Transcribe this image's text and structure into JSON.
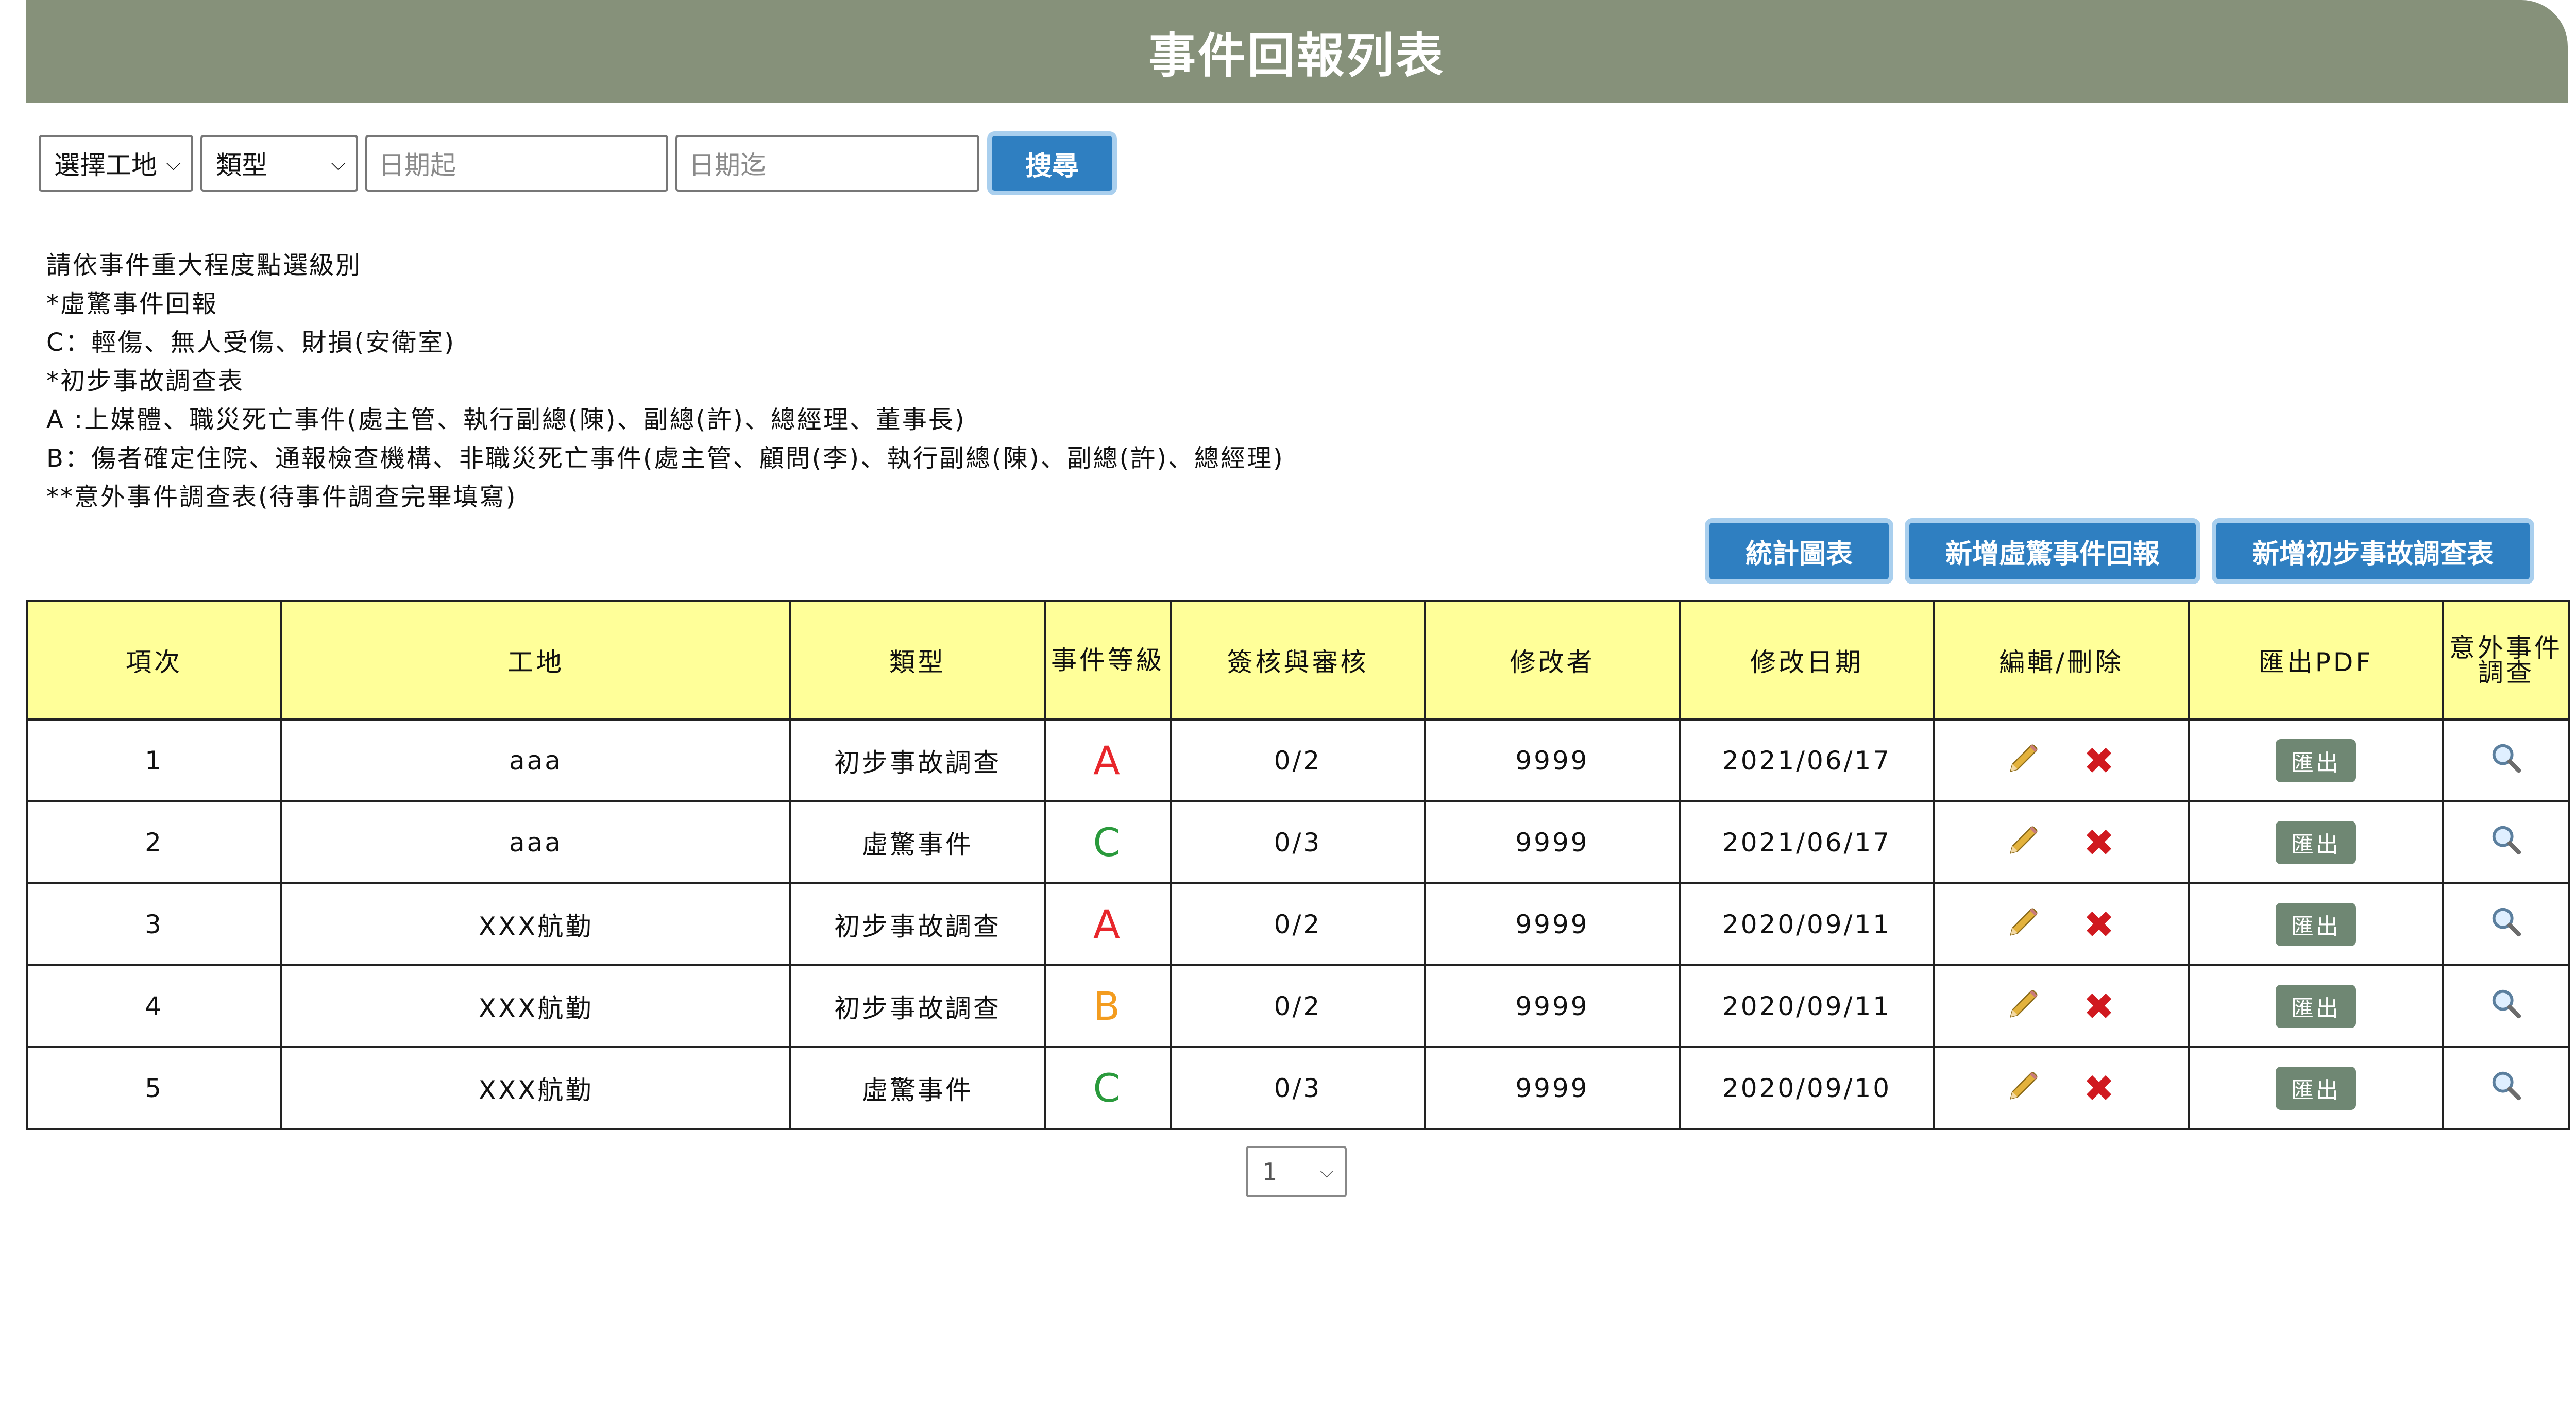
{
  "header": {
    "title": "事件回報列表"
  },
  "filters": {
    "site_select": "選擇工地",
    "type_select": "類型",
    "date_from_placeholder": "日期起",
    "date_to_placeholder": "日期迄",
    "search_label": "搜尋"
  },
  "instructions": [
    "請依事件重大程度點選級別",
    "*虛驚事件回報",
    "C：輕傷、無人受傷、財損(安衛室)",
    "*初步事故調查表",
    "A :上媒體、職災死亡事件(處主管、執行副總(陳)、副總(許)、總經理、董事長)",
    "B：傷者確定住院、通報檢查機構、非職災死亡事件(處主管、顧問(李)、執行副總(陳)、副總(許)、總經理)",
    "**意外事件調查表(待事件調查完畢填寫)"
  ],
  "actions": {
    "stats_chart": "統計圖表",
    "add_near_miss": "新增虛驚事件回報",
    "add_investigation": "新增初步事故調查表"
  },
  "table": {
    "headers": {
      "index": "項次",
      "site": "工地",
      "type": "類型",
      "grade": "事件等級",
      "review": "簽核與審核",
      "modifier": "修改者",
      "modified_date": "修改日期",
      "edit_delete": "編輯/刪除",
      "export_pdf": "匯出PDF",
      "accident": "意外事件調查"
    },
    "export_label": "匯出",
    "rows": [
      {
        "index": "1",
        "site": "aaa",
        "type": "初步事故調查",
        "grade": "A",
        "review": "0/2",
        "modifier": "9999",
        "date": "2021/06/17"
      },
      {
        "index": "2",
        "site": "aaa",
        "type": "虛驚事件",
        "grade": "C",
        "review": "0/3",
        "modifier": "9999",
        "date": "2021/06/17"
      },
      {
        "index": "3",
        "site": "XXX航勤",
        "type": "初步事故調查",
        "grade": "A",
        "review": "0/2",
        "modifier": "9999",
        "date": "2020/09/11"
      },
      {
        "index": "4",
        "site": "XXX航勤",
        "type": "初步事故調查",
        "grade": "B",
        "review": "0/2",
        "modifier": "9999",
        "date": "2020/09/11"
      },
      {
        "index": "5",
        "site": "XXX航勤",
        "type": "虛驚事件",
        "grade": "C",
        "review": "0/3",
        "modifier": "9999",
        "date": "2020/09/10"
      }
    ]
  },
  "grade_colors": {
    "A": "#e8262b",
    "B": "#f39c1f",
    "C": "#2a9a3c"
  },
  "icons": {
    "edit": "pencil-icon",
    "delete": "delete-x-icon",
    "view": "magnifier-icon"
  },
  "pagination": {
    "current_page": "1"
  }
}
